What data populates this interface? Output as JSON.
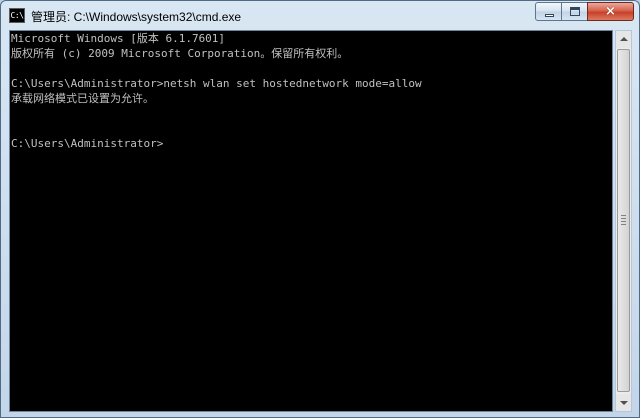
{
  "window": {
    "title": "管理员: C:\\Windows\\system32\\cmd.exe",
    "icon_label": "C:\\"
  },
  "controls": {
    "minimize": "minimize-icon",
    "maximize": "maximize-icon",
    "close": "×"
  },
  "console": {
    "lines": [
      "Microsoft Windows [版本 6.1.7601]",
      "版权所有 (c) 2009 Microsoft Corporation。保留所有权利。",
      "",
      "C:\\Users\\Administrator>netsh wlan set hostednetwork mode=allow",
      "承载网络模式已设置为允许。",
      "",
      "",
      "C:\\Users\\Administrator>"
    ],
    "text_color": "#c0c0c0",
    "background": "#000000"
  }
}
